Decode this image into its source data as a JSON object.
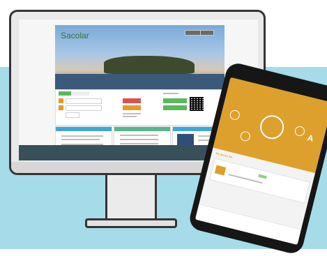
{
  "website": {
    "logo": "Sacolar",
    "header_buttons": [
      "",
      ""
    ],
    "login": {
      "tabs": [
        "",
        ""
      ],
      "buttons": [
        "",
        ""
      ],
      "captcha": "",
      "app_buttons": [
        "",
        ""
      ]
    },
    "cards": [
      "",
      "",
      ""
    ]
  },
  "phone": {
    "header_title": "",
    "device_list_label": "My device list",
    "device_name": "",
    "tabs": [
      "",
      "",
      "",
      ""
    ]
  },
  "colors": {
    "band": "#a6dbe9",
    "orange": "#dda02c",
    "login_green": "#5bb85b",
    "login_red": "#d9534f",
    "card_blue": "#3ea7d8",
    "footer": "#37505a"
  }
}
